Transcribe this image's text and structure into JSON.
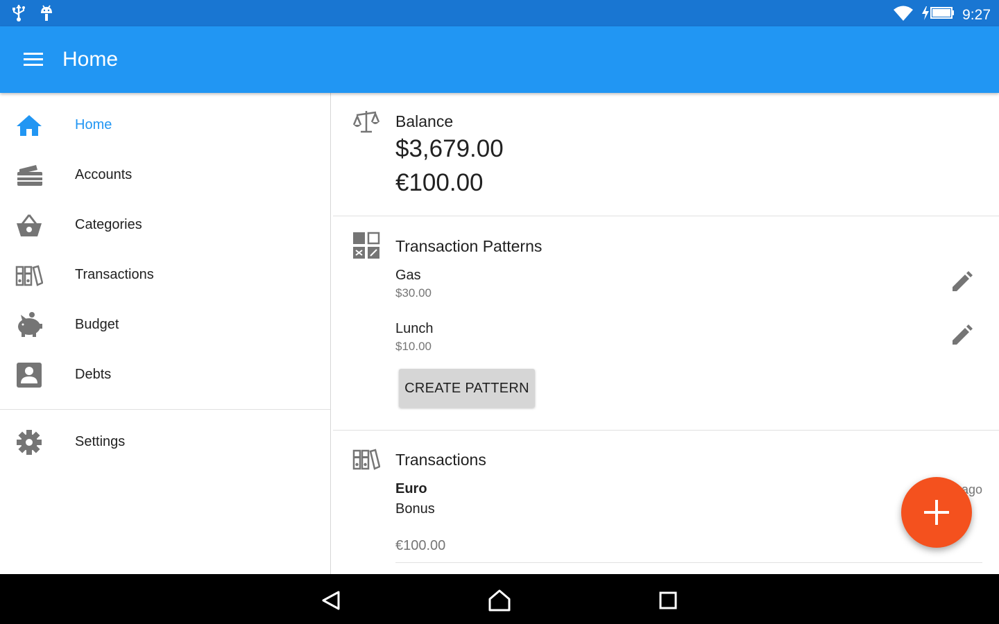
{
  "status_bar": {
    "time": "9:27",
    "left_icons": [
      "usb-icon",
      "android-debug-icon"
    ],
    "right_icons": [
      "wifi-icon",
      "battery-charging-icon"
    ]
  },
  "app_bar": {
    "title": "Home",
    "menu_icon": "hamburger-menu-icon"
  },
  "drawer": {
    "items": [
      {
        "label": "Home",
        "icon": "home-icon",
        "active": true
      },
      {
        "label": "Accounts",
        "icon": "cards-icon"
      },
      {
        "label": "Categories",
        "icon": "basket-icon"
      },
      {
        "label": "Transactions",
        "icon": "binders-icon"
      },
      {
        "label": "Budget",
        "icon": "piggy-bank-icon"
      },
      {
        "label": "Debts",
        "icon": "person-box-icon"
      }
    ],
    "settings": {
      "label": "Settings",
      "icon": "gear-icon"
    }
  },
  "balance": {
    "title": "Balance",
    "icon": "scales-icon",
    "amounts": [
      "$3,679.00",
      "€100.00"
    ]
  },
  "patterns": {
    "title": "Transaction Patterns",
    "icon": "calculator-icon",
    "items": [
      {
        "name": "Gas",
        "value": "$30.00"
      },
      {
        "name": "Lunch",
        "value": "$10.00"
      }
    ],
    "create_label": "CREATE PATTERN"
  },
  "transactions": {
    "title": "Transactions",
    "icon": "binders-icon",
    "items": [
      {
        "account": "Euro",
        "category": "Bonus",
        "amount": "€100.00",
        "time_fragment": "ago"
      }
    ]
  },
  "fab": {
    "icon": "plus-icon"
  },
  "nav_bar": {
    "buttons": [
      "back-icon",
      "home-icon",
      "recents-icon"
    ]
  },
  "colors": {
    "status_bar": "#1976d2",
    "app_bar": "#2196f3",
    "accent": "#2196f3",
    "fab": "#f4511e",
    "icon_gray": "#757575"
  }
}
